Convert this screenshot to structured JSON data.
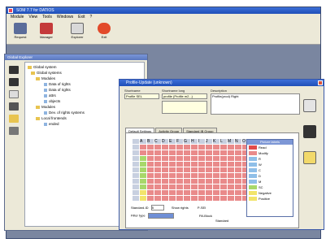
{
  "app": {
    "title": "SOM 7.7 for DATIOS"
  },
  "menu": [
    "Module",
    "View",
    "Tools",
    "Windows",
    "Exit",
    "?"
  ],
  "toolbar": [
    {
      "label": "Request",
      "icon": "monitor-icon",
      "color": "#5a6c9a"
    },
    {
      "label": "Manager",
      "icon": "books-icon",
      "color": "#c43a3a"
    },
    {
      "label": "Explorer",
      "icon": "magnifier-icon",
      "color": "#d8d8d8"
    },
    {
      "label": "Exit",
      "icon": "stop-icon",
      "color": "#e24a2a"
    }
  ],
  "explorer": {
    "title": "Global Explorer",
    "tree": [
      "Global system",
      "Global systems",
      "Modules",
      "Data of rights",
      "Data of rights",
      "attrs",
      "objects",
      "Modules",
      "Dev. of rights systems",
      "Local frontends",
      "ended"
    ]
  },
  "dialog": {
    "title": "Profile-Update (unknown)",
    "labels": {
      "short": "Shortname",
      "long": "Shortname long",
      "desc": "Description"
    },
    "values": {
      "short": "Profile SEL",
      "long": "profile (Profile m2...)",
      "desc": "Profile(prod) Right"
    },
    "tabs": [
      "Default Settings",
      "Activity Group",
      "Standard IB Group"
    ],
    "grid_headers": [
      "A",
      "B",
      "C",
      "D",
      "E",
      "F",
      "G",
      "H",
      "I",
      "J",
      "K",
      "L",
      "M",
      "N",
      "O",
      "P"
    ],
    "legend_title": "Picture labels",
    "legend": [
      {
        "label": "Read",
        "color": "#e24a4a"
      },
      {
        "label": "Modify",
        "color": "#e98a8a"
      },
      {
        "label": "R",
        "color": "#8fbfe8"
      },
      {
        "label": "W",
        "color": "#8fbfe8"
      },
      {
        "label": "C",
        "color": "#8fbfe8"
      },
      {
        "label": "D",
        "color": "#8fbfe8"
      },
      {
        "label": "M",
        "color": "#8fbfe8"
      },
      {
        "label": "SC",
        "color": "#a8d86a"
      },
      {
        "label": "Negative",
        "color": "#f2e46a"
      },
      {
        "label": "Positive",
        "color": "#f2e46a"
      }
    ],
    "bottom": {
      "standard_label": "Standard-ID",
      "standard_val": "5",
      "show_label": "Show rights",
      "filter_label": "Filter type",
      "opts": [
        "P-SEI",
        "Fill-Block",
        "Standard"
      ]
    }
  }
}
